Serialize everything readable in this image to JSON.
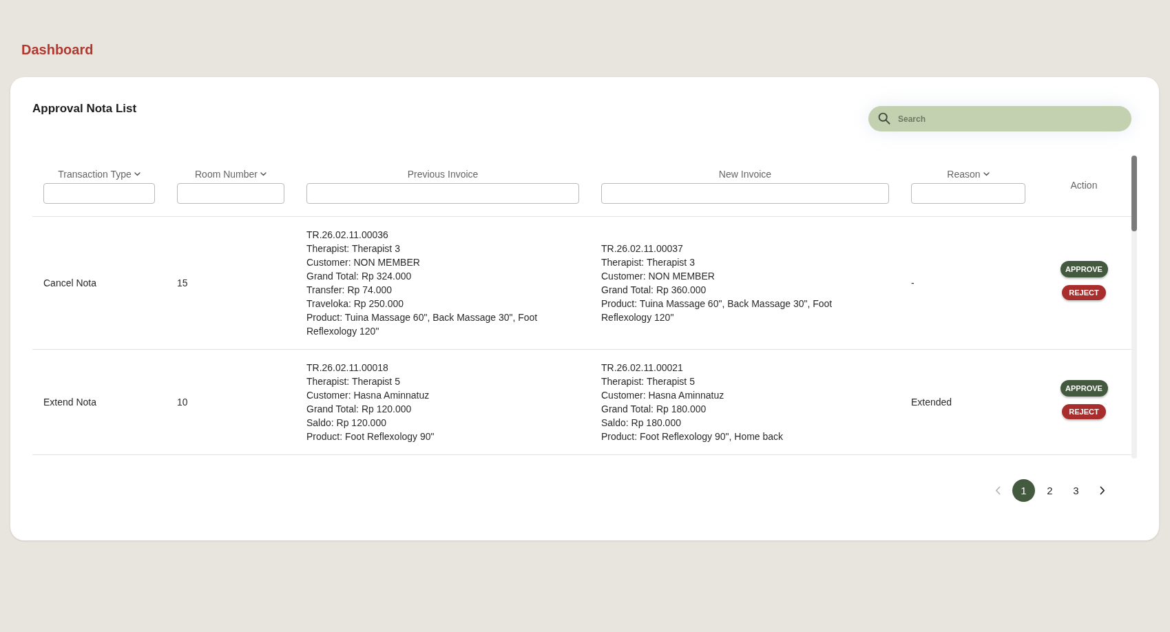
{
  "page_title": "Dashboard",
  "card": {
    "title": "Approval Nota List",
    "search": {
      "placeholder": "Search"
    }
  },
  "table": {
    "columns": [
      {
        "label": "Transaction Type",
        "dropdown": true,
        "filter": true
      },
      {
        "label": "Room Number",
        "dropdown": true,
        "filter": true
      },
      {
        "label": "Previous Invoice",
        "dropdown": false,
        "filter": true
      },
      {
        "label": "New Invoice",
        "dropdown": false,
        "filter": true
      },
      {
        "label": "Reason",
        "dropdown": true,
        "filter": true
      },
      {
        "label": "Action",
        "dropdown": false,
        "filter": false
      }
    ],
    "rows": [
      {
        "transaction_type": "Cancel Nota",
        "room_number": "15",
        "previous_invoice": {
          "number": "TR.26.02.11.00036",
          "details": [
            "Therapist: Therapist 3",
            "Customer: NON MEMBER",
            "Grand Total: Rp 324.000",
            "Transfer: Rp 74.000",
            "Traveloka: Rp 250.000",
            "Product: Tuina Massage 60\", Back Massage 30\", Foot Reflexology 120\""
          ]
        },
        "new_invoice": {
          "number": "TR.26.02.11.00037",
          "details": [
            "Therapist: Therapist 3",
            "Customer: NON MEMBER",
            "Grand Total: Rp 360.000",
            "Product: Tuina Massage 60\", Back Massage 30\", Foot Reflexology 120\""
          ]
        },
        "reason": "-",
        "actions": [
          {
            "kind": "approve",
            "label": "APPROVE"
          },
          {
            "kind": "reject",
            "label": "REJECT"
          }
        ]
      },
      {
        "transaction_type": "Extend Nota",
        "room_number": "10",
        "previous_invoice": {
          "number": "TR.26.02.11.00018",
          "details": [
            "Therapist: Therapist 5",
            "Customer: Hasna Aminnatuz",
            "Grand Total: Rp 120.000",
            "Saldo: Rp 120.000",
            "Product: Foot Reflexology 90\""
          ]
        },
        "new_invoice": {
          "number": "TR.26.02.11.00021",
          "details": [
            "Therapist: Therapist 5",
            "Customer: Hasna Aminnatuz",
            "Grand Total: Rp 180.000",
            "Saldo: Rp 180.000",
            "Product: Foot Reflexology 90\", Home back"
          ]
        },
        "reason": "Extended",
        "actions": [
          {
            "kind": "approve",
            "label": "APPROVE"
          },
          {
            "kind": "reject",
            "label": "REJECT"
          }
        ]
      }
    ]
  },
  "pagination": {
    "previous": {
      "disabled": true
    },
    "pages": [
      {
        "label": "1",
        "selected": true
      },
      {
        "label": "2",
        "selected": false
      },
      {
        "label": "3",
        "selected": false
      }
    ],
    "next": {
      "disabled": false
    }
  }
}
